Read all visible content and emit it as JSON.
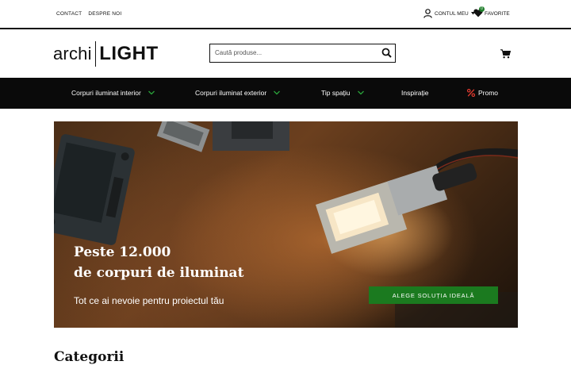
{
  "topbar": {
    "links": [
      "CONTACT",
      "DESPRE NOI"
    ],
    "account_label": "CONTUL MEU",
    "favorites_label": "FAVORITE",
    "favorites_count": "0"
  },
  "header": {
    "logo_part1": "archi",
    "logo_part2": "LIGHT",
    "search_placeholder": "Caută produse...",
    "search_value": ""
  },
  "nav": {
    "items": [
      {
        "label": "Corpuri iluminat interior",
        "has_dropdown": true
      },
      {
        "label": "Corpuri iluminat exterior",
        "has_dropdown": true
      },
      {
        "label": "Tip spațiu",
        "has_dropdown": true
      },
      {
        "label": "Inspirație",
        "has_dropdown": false
      },
      {
        "label": "Promo",
        "has_dropdown": false,
        "icon": "percent-icon"
      }
    ]
  },
  "hero": {
    "title_line1": "Peste 12.000",
    "title_line2": "de corpuri de iluminat",
    "subtitle": "Tot ce ai nevoie pentru proiectul tău",
    "cta_label": "ALEGE SOLUȚIA IDEALĂ"
  },
  "sections": {
    "categories_title": "Categorii"
  },
  "colors": {
    "accent": "#1b7a1f",
    "nav_bg": "#0a0a0a",
    "promo_icon": "#e03a2f"
  }
}
